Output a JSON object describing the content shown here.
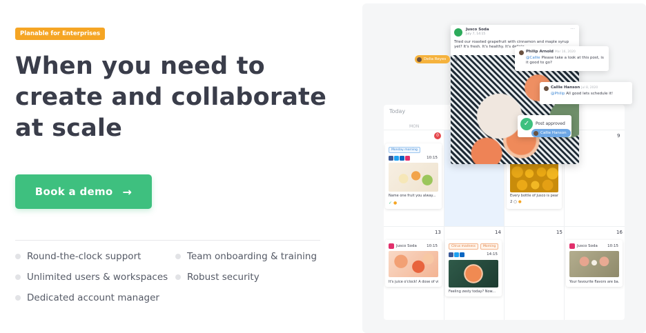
{
  "hero": {
    "badge": "Planable for Enterprises",
    "headline": [
      "When you need to",
      "create and collaborate",
      "at scale"
    ],
    "cta_label": "Book a demo",
    "cta_arrow": "→",
    "features": [
      "Round-the-clock support",
      "Team onboarding & training",
      "Unlimited users & workspaces",
      "Robust security",
      "Dedicated account manager"
    ]
  },
  "colors": {
    "accent": "#3ec07f",
    "badge": "#f5a524",
    "headline": "#3a3d4a"
  },
  "calendar": {
    "today_label": "Today",
    "mon_label": "MON",
    "badge_count": "0",
    "day_numbers": [
      "9",
      "13",
      "14",
      "15",
      "16"
    ],
    "cards": {
      "monday": {
        "tag": "Monday morning",
        "time": "10:15",
        "caption": "Name one fruit you alway..."
      },
      "lemons": {
        "caption": "Every bottle of Jusco is pear...",
        "comments": "2"
      },
      "c13": {
        "brand": "Jusco Soda",
        "time": "10:15",
        "caption": "It's juice o'clock! A dose of vit..."
      },
      "c14": {
        "tag1": "Citrus madness",
        "tag2": "Morning",
        "time": "14:15",
        "caption": "Feeling zesty today? Now..."
      },
      "c16": {
        "brand": "Jusco Soda",
        "time": "10:15",
        "caption": "Your favourite flavors are ba..."
      }
    }
  },
  "post": {
    "brand": "Jusco Soda",
    "date": "July 7, 14:15",
    "more": "···",
    "text": "Tried our roasted grapefruit with cinnamon and maple syrup yet? It's fresh. It's healthy. It's delicio"
  },
  "comments": [
    {
      "name": "Philip Arnold",
      "date": "Mar 16, 2020",
      "mention": "@Callie",
      "body": "Please take a look at this post, is it good to go?"
    },
    {
      "name": "Callie Hanson",
      "date": "Jul 8, 2020",
      "mention": "@Philip",
      "body": "All good lets schedule it!"
    }
  ],
  "pills": {
    "delia": "Delia Reyes",
    "callie": "Callie Hanson"
  },
  "approved": {
    "label": "Post approved"
  }
}
